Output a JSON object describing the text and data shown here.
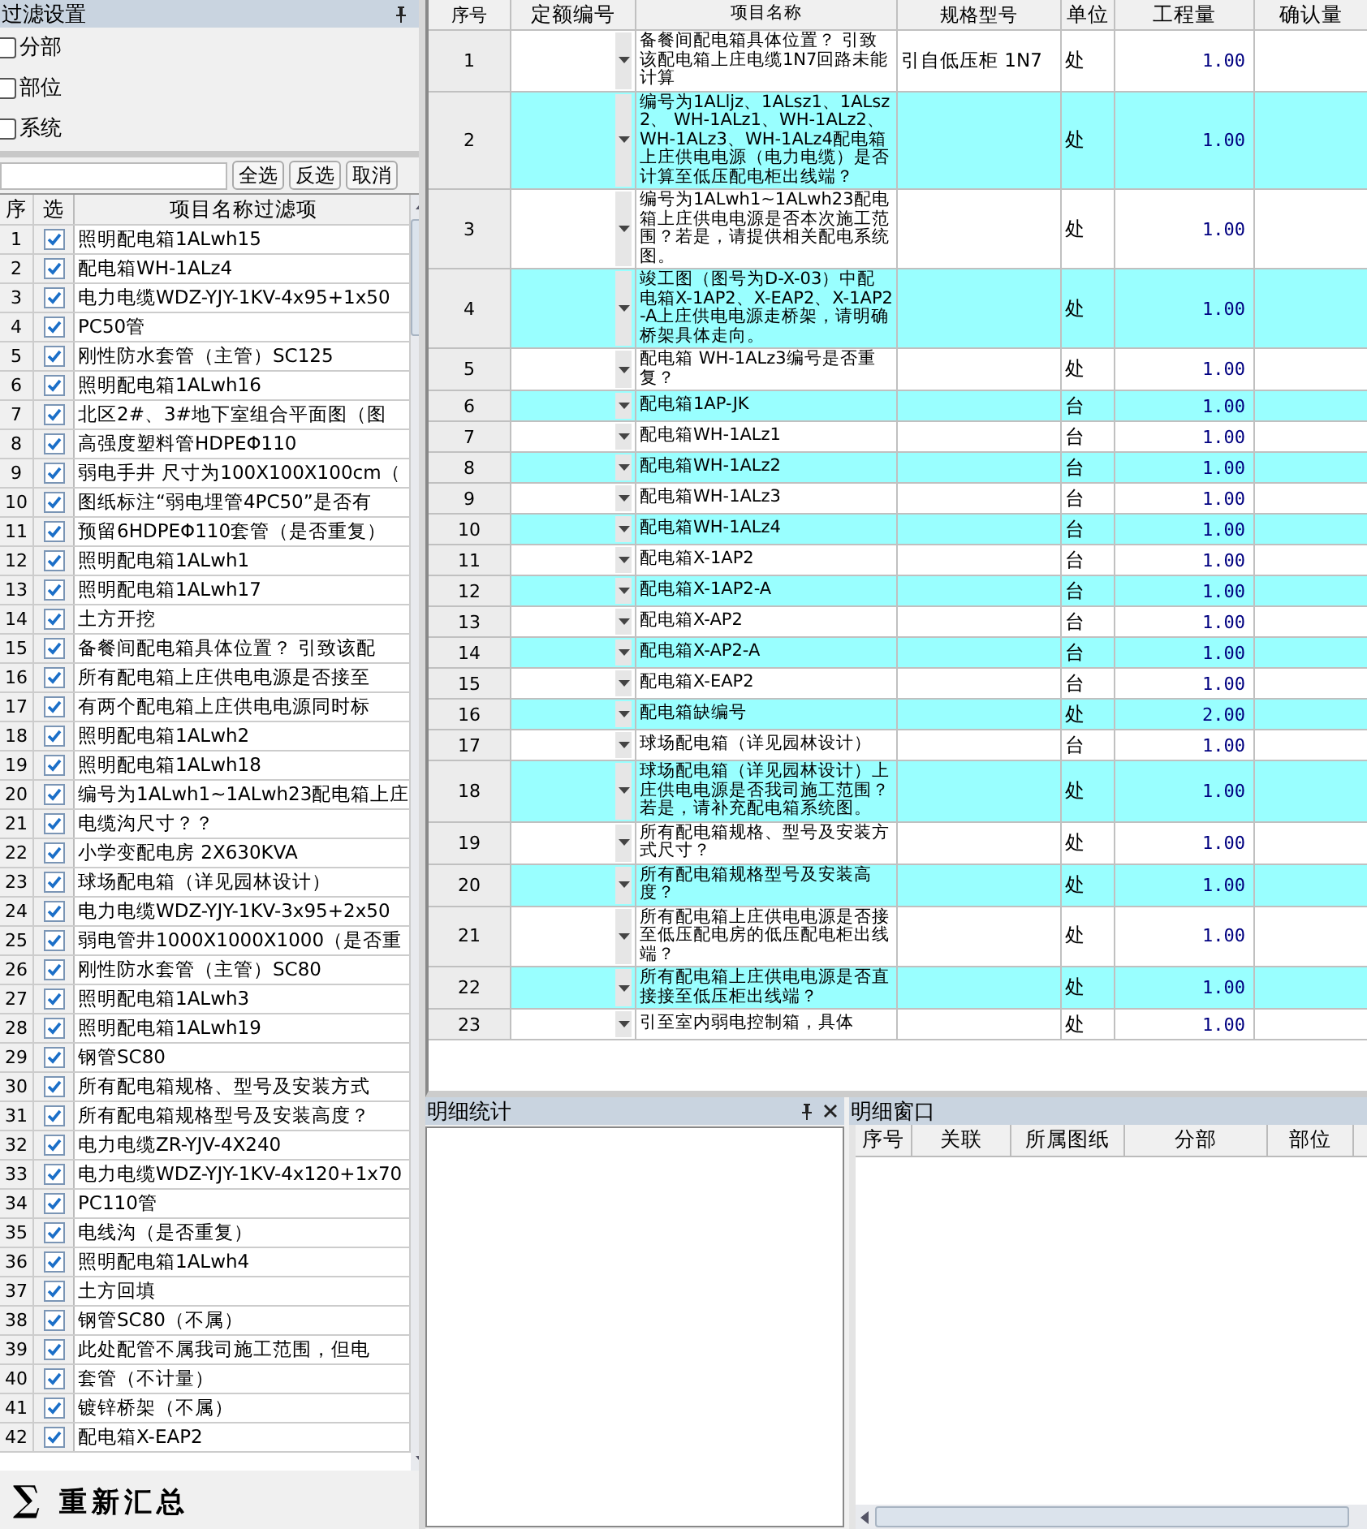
{
  "filter_panel": {
    "title": "过滤设置",
    "options": [
      {
        "label": "分部",
        "checked": false
      },
      {
        "label": "部位",
        "checked": false
      },
      {
        "label": "系统",
        "checked": false
      }
    ],
    "buttons": [
      "全选",
      "反选",
      "取消"
    ],
    "columns": [
      "序",
      "选",
      "项目名称过滤项"
    ],
    "items": [
      {
        "no": "1",
        "name": "照明配电箱1ALwh15",
        "checked": true
      },
      {
        "no": "2",
        "name": "配电箱WH-1ALz4",
        "checked": true
      },
      {
        "no": "3",
        "name": "电力电缆WDZ-YJY-1KV-4x95+1x50",
        "checked": true
      },
      {
        "no": "4",
        "name": "PC50管",
        "checked": true
      },
      {
        "no": "5",
        "name": "刚性防水套管（主管）SC125",
        "checked": true
      },
      {
        "no": "6",
        "name": "照明配电箱1ALwh16",
        "checked": true
      },
      {
        "no": "7",
        "name": "北区2#、3#地下室组合平面图（图",
        "checked": true
      },
      {
        "no": "8",
        "name": "高强度塑料管HDPEΦ110",
        "checked": true
      },
      {
        "no": "9",
        "name": "弱电手井 尺寸为100X100X100cm（",
        "checked": true
      },
      {
        "no": "10",
        "name": "图纸标注“弱电埋管4PC50”是否有",
        "checked": true
      },
      {
        "no": "11",
        "name": "预留6HDPEΦ110套管（是否重复）",
        "checked": true
      },
      {
        "no": "12",
        "name": "照明配电箱1ALwh1",
        "checked": true
      },
      {
        "no": "13",
        "name": "照明配电箱1ALwh17",
        "checked": true
      },
      {
        "no": "14",
        "name": "土方开挖",
        "checked": true
      },
      {
        "no": "15",
        "name": "备餐间配电箱具体位置？ 引致该配",
        "checked": true
      },
      {
        "no": "16",
        "name": "所有配电箱上庄供电电源是否接至",
        "checked": true
      },
      {
        "no": "17",
        "name": "有两个配电箱上庄供电电源同时标",
        "checked": true
      },
      {
        "no": "18",
        "name": "照明配电箱1ALwh2",
        "checked": true
      },
      {
        "no": "19",
        "name": "照明配电箱1ALwh18",
        "checked": true
      },
      {
        "no": "20",
        "name": "编号为1ALwh1~1ALwh23配电箱上庄",
        "checked": true
      },
      {
        "no": "21",
        "name": "电缆沟尺寸？？",
        "checked": true
      },
      {
        "no": "22",
        "name": "小学变配电房 2X630KVA",
        "checked": true
      },
      {
        "no": "23",
        "name": "球场配电箱（详见园林设计）",
        "checked": true
      },
      {
        "no": "24",
        "name": "电力电缆WDZ-YJY-1KV-3x95+2x50",
        "checked": true
      },
      {
        "no": "25",
        "name": "弱电管井1000X1000X1000（是否重",
        "checked": true
      },
      {
        "no": "26",
        "name": "刚性防水套管（主管）SC80",
        "checked": true
      },
      {
        "no": "27",
        "name": "照明配电箱1ALwh3",
        "checked": true
      },
      {
        "no": "28",
        "name": "照明配电箱1ALwh19",
        "checked": true
      },
      {
        "no": "29",
        "name": "钢管SC80",
        "checked": true
      },
      {
        "no": "30",
        "name": "所有配电箱规格、型号及安装方式",
        "checked": true
      },
      {
        "no": "31",
        "name": "所有配电箱规格型号及安装高度？",
        "checked": true
      },
      {
        "no": "32",
        "name": "电力电缆ZR-YJV-4X240",
        "checked": true
      },
      {
        "no": "33",
        "name": "电力电缆WDZ-YJY-1KV-4x120+1x70",
        "checked": true
      },
      {
        "no": "34",
        "name": "PC110管",
        "checked": true
      },
      {
        "no": "35",
        "name": "电线沟（是否重复）",
        "checked": true
      },
      {
        "no": "36",
        "name": "照明配电箱1ALwh4",
        "checked": true
      },
      {
        "no": "37",
        "name": "土方回填",
        "checked": true
      },
      {
        "no": "38",
        "name": "钢管SC80（不属）",
        "checked": true
      },
      {
        "no": "39",
        "name": "此处配管不属我司施工范围，但电",
        "checked": true
      },
      {
        "no": "40",
        "name": "套管（不计量）",
        "checked": true
      },
      {
        "no": "41",
        "name": "镀锌桥架（不属）",
        "checked": true
      },
      {
        "no": "42",
        "name": "配电箱X-EAP2",
        "checked": true
      }
    ],
    "resummarize_button": {
      "symbol": "∑",
      "label": "重新汇总"
    }
  },
  "main_table": {
    "columns": [
      "序号",
      "定额编号",
      "项目名称",
      "规格型号",
      "单位",
      "工程量",
      "确认量"
    ],
    "rows": [
      {
        "no": "1",
        "name": "备餐间配电箱具体位置？ 引致该配电箱上庄电缆1N7回路未能计算",
        "spec": "引自低压柜 1N7",
        "unit": "处",
        "quantity": "1.00",
        "highlighted": false
      },
      {
        "no": "2",
        "name": "编号为1ALljz、1ALsz1、1ALsz2、 WH-1ALz1、WH-1ALz2、 WH-1ALz3、WH-1ALz4配电箱上庄供电电源（电力电缆）是否计算至低压配电柜出线端？",
        "unit": "处",
        "quantity": "1.00",
        "highlighted": true
      },
      {
        "no": "3",
        "name": "编号为1ALwh1~1ALwh23配电箱上庄供电电源是否本次施工范围？若是，请提供相关配电系统图。",
        "unit": "处",
        "quantity": "1.00",
        "highlighted": false
      },
      {
        "no": "4",
        "name": "竣工图（图号为D-X-03）中配电箱X-1AP2、X-EAP2、X-1AP2-A上庄供电电源走桥架，请明确桥架具体走向。",
        "unit": "处",
        "quantity": "1.00",
        "highlighted": true
      },
      {
        "no": "5",
        "name": "配电箱 WH-1ALz3编号是否重复？",
        "unit": "处",
        "quantity": "1.00",
        "highlighted": false
      },
      {
        "no": "6",
        "name": "配电箱1AP-JK",
        "unit": "台",
        "quantity": "1.00",
        "highlighted": true
      },
      {
        "no": "7",
        "name": "配电箱WH-1ALz1",
        "unit": "台",
        "quantity": "1.00",
        "highlighted": false
      },
      {
        "no": "8",
        "name": "配电箱WH-1ALz2",
        "unit": "台",
        "quantity": "1.00",
        "highlighted": true
      },
      {
        "no": "9",
        "name": "配电箱WH-1ALz3",
        "unit": "台",
        "quantity": "1.00",
        "highlighted": false
      },
      {
        "no": "10",
        "name": "配电箱WH-1ALz4",
        "unit": "台",
        "quantity": "1.00",
        "highlighted": true
      },
      {
        "no": "11",
        "name": "配电箱X-1AP2",
        "unit": "台",
        "quantity": "1.00",
        "highlighted": false
      },
      {
        "no": "12",
        "name": "配电箱X-1AP2-A",
        "unit": "台",
        "quantity": "1.00",
        "highlighted": true
      },
      {
        "no": "13",
        "name": "配电箱X-AP2",
        "unit": "台",
        "quantity": "1.00",
        "highlighted": false
      },
      {
        "no": "14",
        "name": "配电箱X-AP2-A",
        "unit": "台",
        "quantity": "1.00",
        "highlighted": true
      },
      {
        "no": "15",
        "name": "配电箱X-EAP2",
        "unit": "台",
        "quantity": "1.00",
        "highlighted": false
      },
      {
        "no": "16",
        "name": "配电箱缺编号",
        "unit": "处",
        "quantity": "2.00",
        "highlighted": true
      },
      {
        "no": "17",
        "name": "球场配电箱（详见园林设计）",
        "unit": "台",
        "quantity": "1.00",
        "highlighted": false
      },
      {
        "no": "18",
        "name": "球场配电箱（详见园林设计）上庄供电电源是否我司施工范围？若是，请补充配电箱系统图。",
        "unit": "处",
        "quantity": "1.00",
        "highlighted": true
      },
      {
        "no": "19",
        "name": "所有配电箱规格、型号及安装方式尺寸？",
        "unit": "处",
        "quantity": "1.00",
        "highlighted": false
      },
      {
        "no": "20",
        "name": "所有配电箱规格型号及安装高度？",
        "unit": "处",
        "quantity": "1.00",
        "highlighted": true
      },
      {
        "no": "21",
        "name": "所有配电箱上庄供电电源是否接至低压配电房的低压配电柜出线端？",
        "unit": "处",
        "quantity": "1.00",
        "highlighted": false
      },
      {
        "no": "22",
        "name": "所有配电箱上庄供电电源是否直接接至低压柜出线端？",
        "unit": "处",
        "quantity": "1.00",
        "highlighted": true
      },
      {
        "no": "23",
        "name": "引至室内弱电控制箱，具体",
        "unit": "处",
        "quantity": "1.00",
        "highlighted": false
      }
    ]
  },
  "detail_stats": {
    "title": "明细统计"
  },
  "detail_window": {
    "title": "明细窗口",
    "columns": [
      "序号",
      "关联",
      "所属图纸",
      "分部",
      "部位"
    ]
  }
}
